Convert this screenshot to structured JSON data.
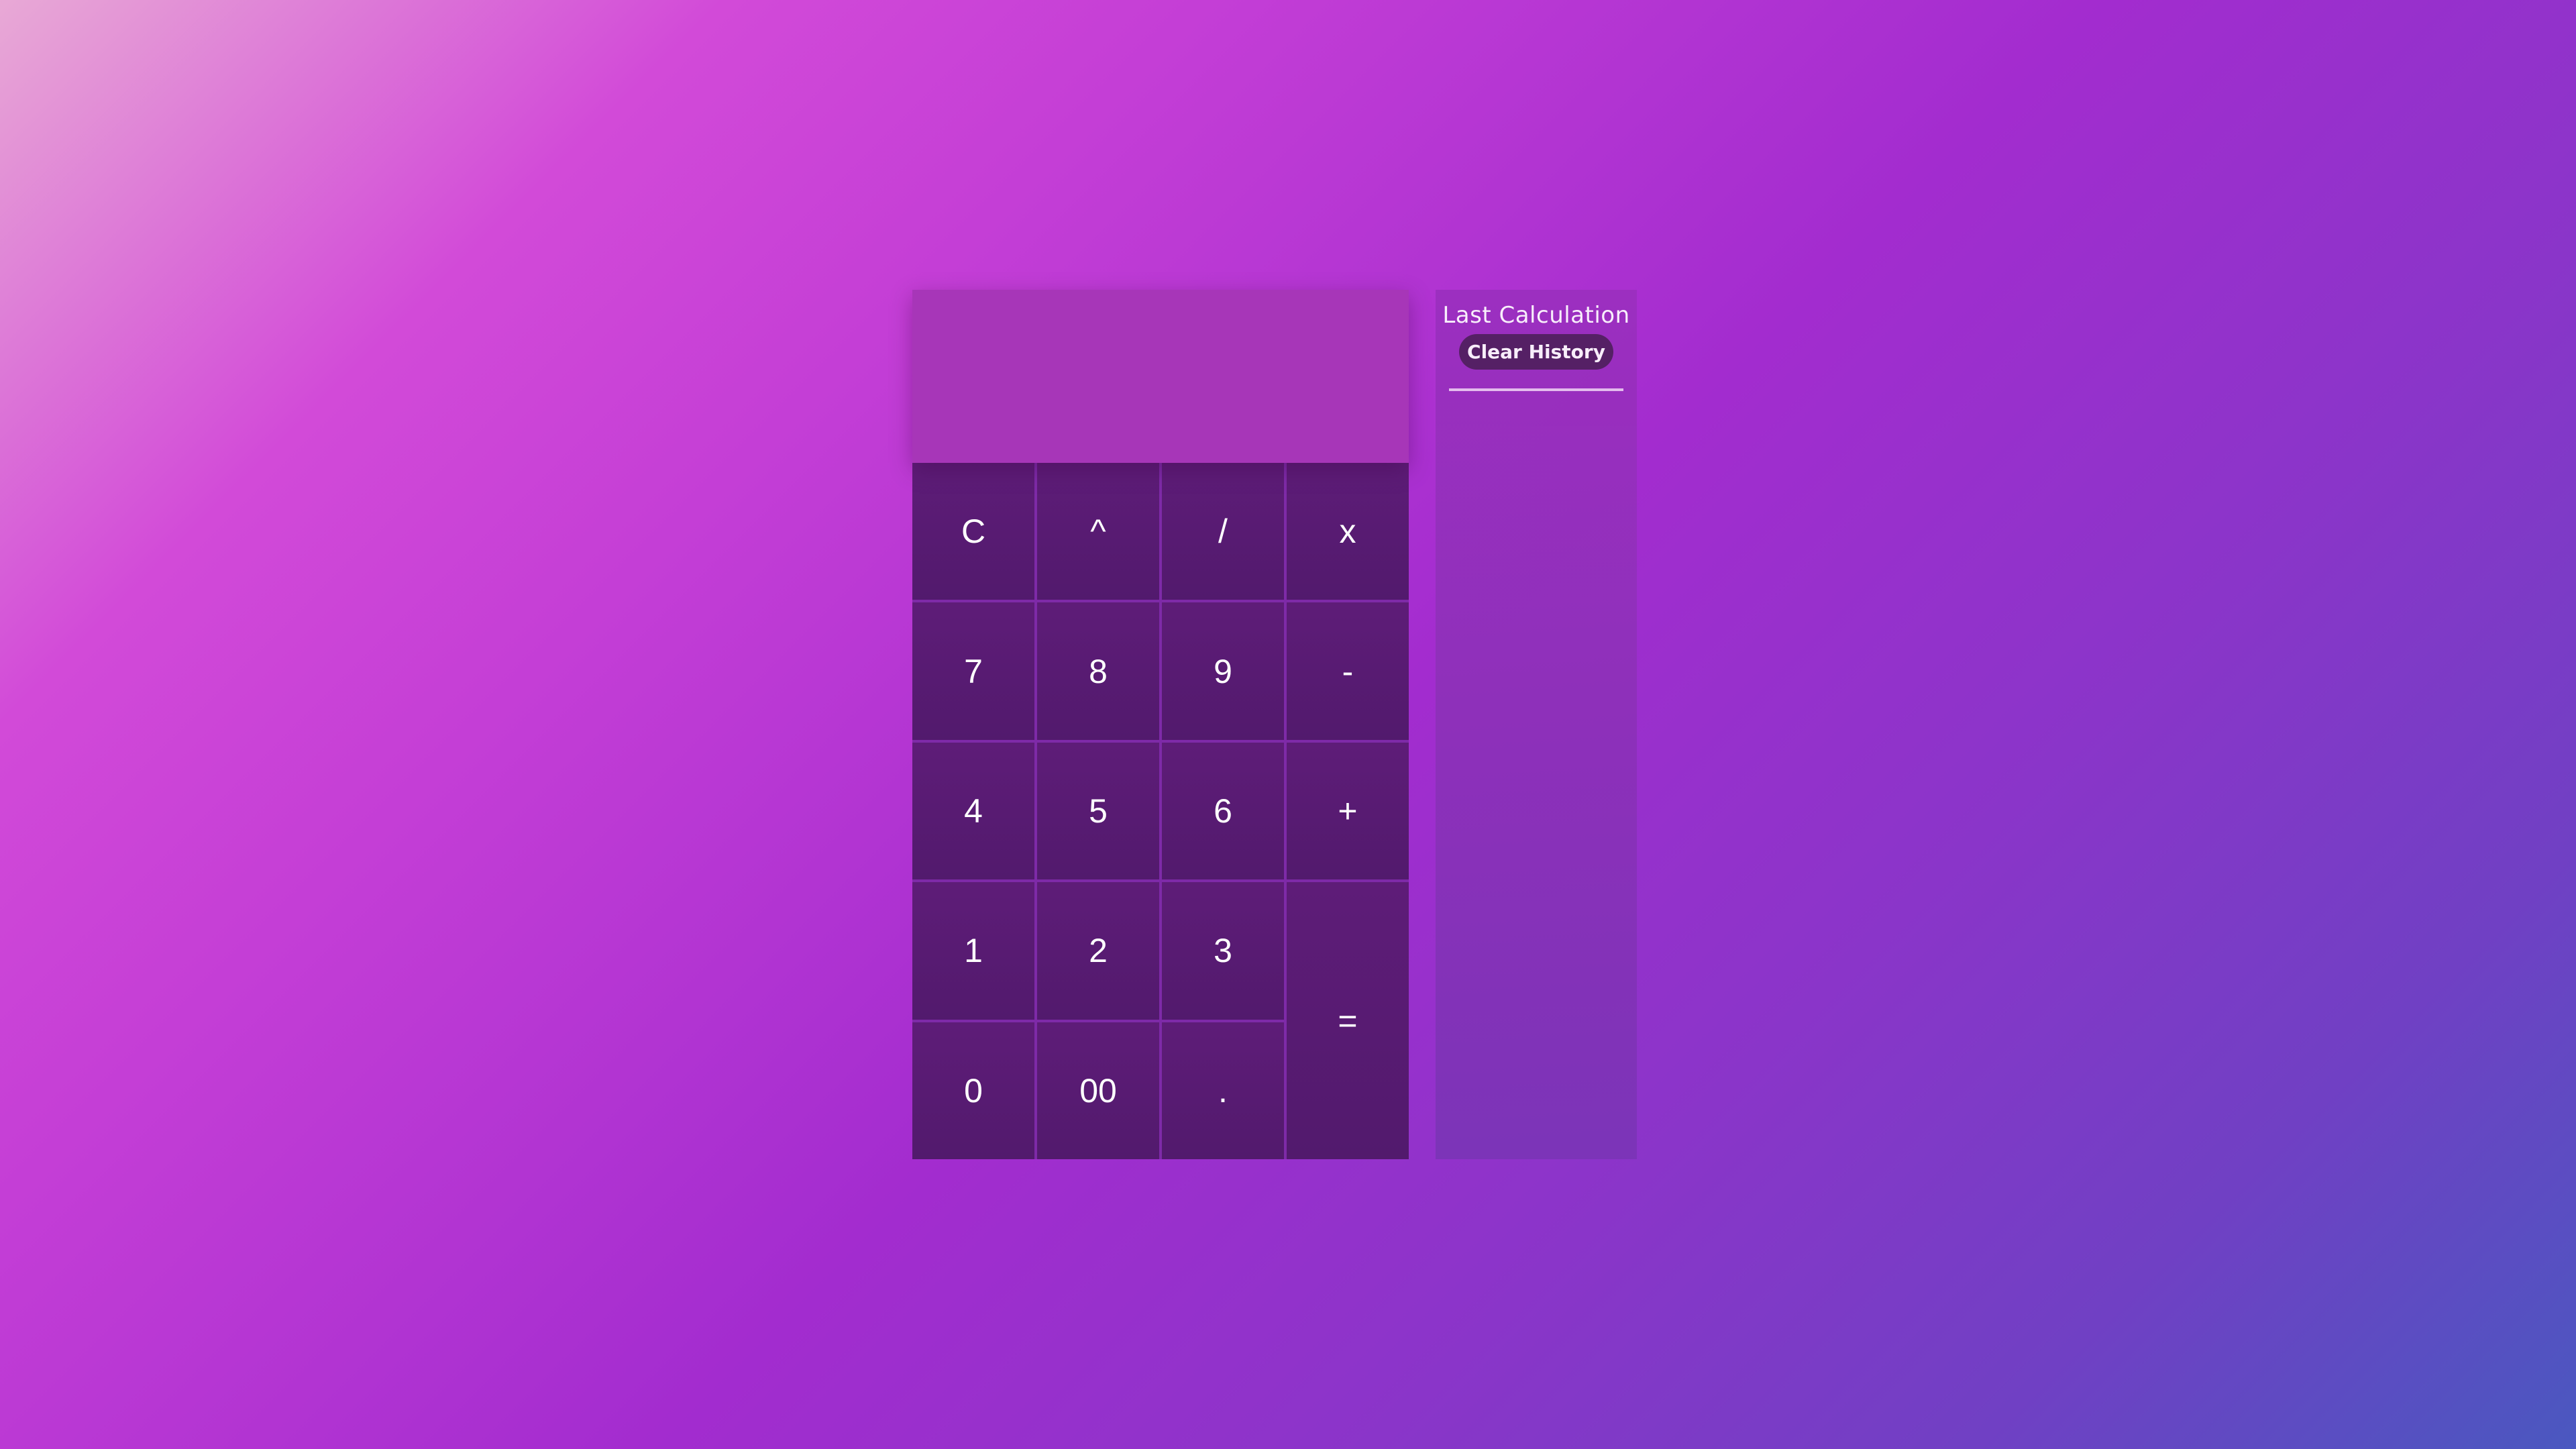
{
  "display": {
    "value": ""
  },
  "keypad": {
    "keys": [
      "C",
      "^",
      "/",
      "x",
      "7",
      "8",
      "9",
      "-",
      "4",
      "5",
      "6",
      "+",
      "1",
      "2",
      "3",
      "=",
      "0",
      "00",
      "."
    ]
  },
  "history": {
    "title": "Last Calculation",
    "clear_label": "Clear History"
  }
}
